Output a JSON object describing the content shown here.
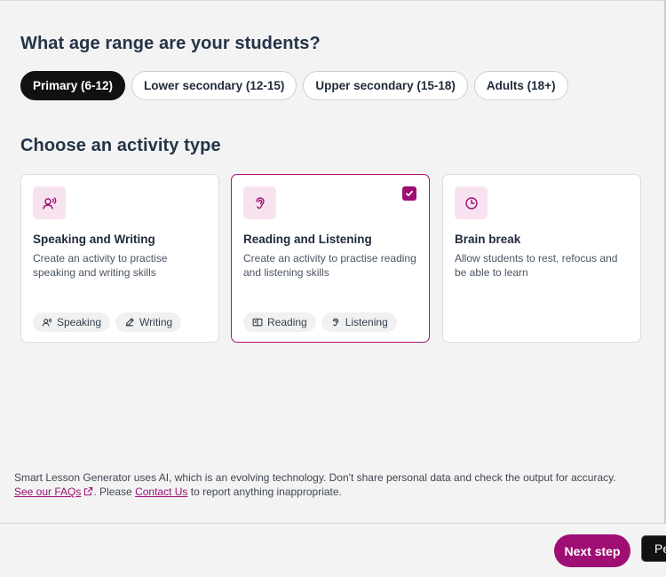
{
  "age_section": {
    "title": "What age range are your students?",
    "options": [
      {
        "label": "Primary (6-12)",
        "selected": true
      },
      {
        "label": "Lower secondary (12-15)",
        "selected": false
      },
      {
        "label": "Upper secondary (15-18)",
        "selected": false
      },
      {
        "label": "Adults (18+)",
        "selected": false
      }
    ]
  },
  "activity_section": {
    "title": "Choose an activity type",
    "cards": [
      {
        "icon": "speaking-icon",
        "title": "Speaking and Writing",
        "description": "Create an activity to practise speaking and writing skills",
        "selected": false,
        "tags": [
          {
            "icon": "speaking-icon",
            "label": "Speaking"
          },
          {
            "icon": "pencil-icon",
            "label": "Writing"
          }
        ]
      },
      {
        "icon": "ear-icon",
        "title": "Reading and Listening",
        "description": "Create an activity to practise reading and listening skills",
        "selected": true,
        "tags": [
          {
            "icon": "book-icon",
            "label": "Reading"
          },
          {
            "icon": "ear-icon",
            "label": "Listening"
          }
        ]
      },
      {
        "icon": "clock-icon",
        "title": "Brain break",
        "description": "Allow students to rest, refocus and be able to learn",
        "selected": false,
        "tags": []
      }
    ]
  },
  "disclaimer": {
    "text_1": "Smart Lesson Generator uses AI, which is an evolving technology. Don't share personal data and check the output for accuracy.",
    "faq_link": "See our FAQs",
    "text_2": ". Please ",
    "contact_link": "Contact Us",
    "text_3": " to report anything inappropriate."
  },
  "footer": {
    "next_label": "Next step",
    "overflow_label": "Pe"
  },
  "colors": {
    "accent": "#9e0e73",
    "icon_bg": "#f7e3f0",
    "pill_selected": "#111111"
  }
}
